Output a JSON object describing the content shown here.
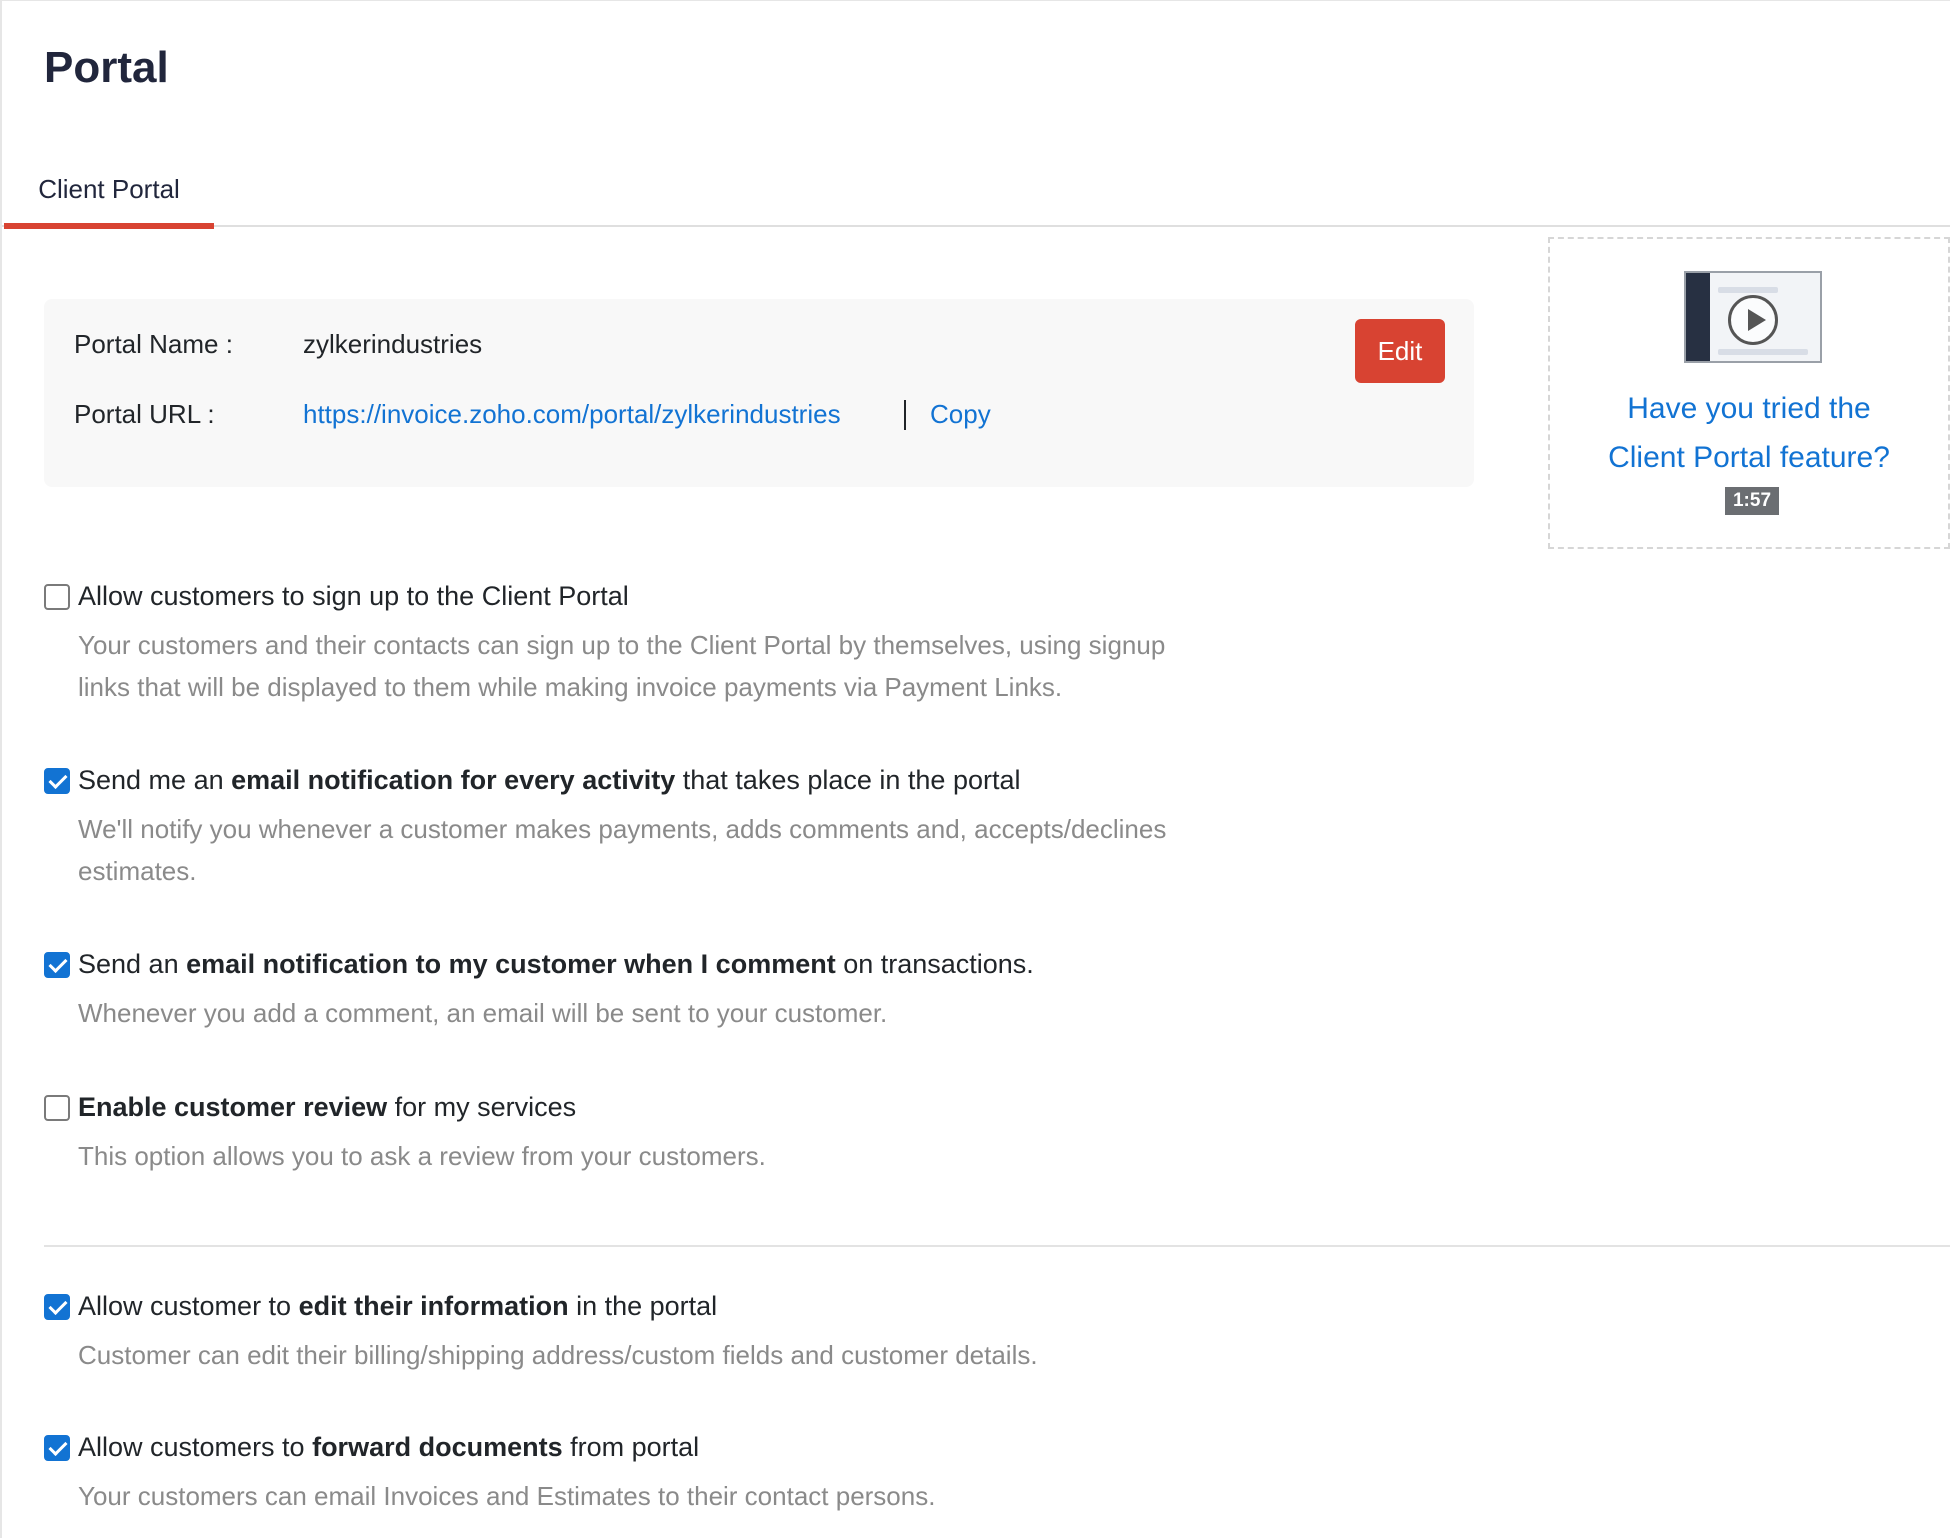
{
  "page": {
    "title": "Portal"
  },
  "tabs": [
    {
      "label": "Client Portal",
      "active": true
    }
  ],
  "portal_info": {
    "name_label": "Portal Name :",
    "name_value": "zylkerindustries",
    "url_label": "Portal URL :",
    "url_value": "https://invoice.zoho.com/portal/zylkerindustries",
    "copy_label": "Copy",
    "edit_label": "Edit"
  },
  "video": {
    "line1": "Have you tried the",
    "line2": "Client Portal feature?",
    "duration": "1:57"
  },
  "options": [
    {
      "checked": false,
      "pre": "Allow customers to sign up to the Client Portal",
      "bold": "",
      "post": "",
      "desc_line1": "Your customers and their contacts can sign up to the Client Portal by themselves, using signup",
      "desc_line2": "links that will be displayed to them while making invoice payments via Payment Links."
    },
    {
      "checked": true,
      "pre": "Send me an ",
      "bold": "email notification for every activity",
      "post": " that takes place in the portal",
      "desc_line1": "We'll notify you whenever a customer makes payments, adds comments and, accepts/declines",
      "desc_line2": "estimates."
    },
    {
      "checked": true,
      "pre": "Send an ",
      "bold": "email notification to my customer when I comment",
      "post": " on transactions.",
      "desc_line1": "Whenever you add a comment, an email will be sent to your customer.",
      "desc_line2": ""
    },
    {
      "checked": false,
      "pre": "",
      "bold": "Enable customer review",
      "post": " for my services",
      "desc_line1": "This option allows you to ask a review from your customers.",
      "desc_line2": ""
    },
    {
      "checked": true,
      "pre": "Allow customer to ",
      "bold": "edit their information",
      "post": " in the portal",
      "desc_line1": "Customer can edit their billing/shipping address/custom fields and customer details.",
      "desc_line2": ""
    },
    {
      "checked": true,
      "pre": "Allow customers to ",
      "bold": "forward documents",
      "post": " from portal",
      "desc_line1": "Your customers can email Invoices and Estimates to their contact persons.",
      "desc_line2": ""
    }
  ],
  "colors": {
    "accent": "#d84332",
    "link": "#1273d3",
    "checkbox": "#1273d3"
  }
}
